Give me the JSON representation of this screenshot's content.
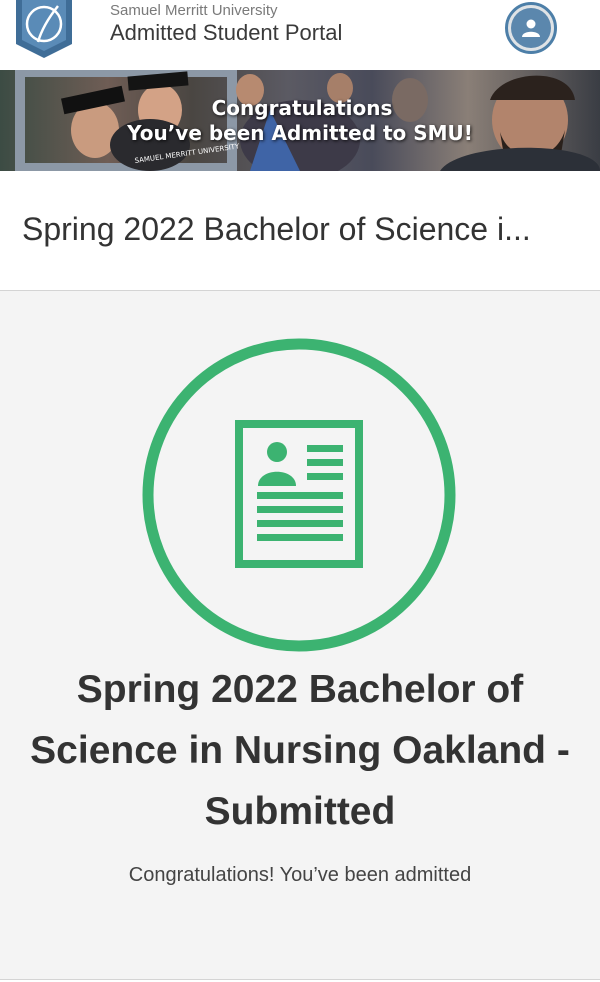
{
  "header": {
    "university": "Samuel Merritt University",
    "portal": "Admitted Student Portal"
  },
  "banner": {
    "line1": "Congratulations",
    "line2": "You’ve been Admitted to SMU!",
    "frame_text": "SAMUEL MERRITT UNIVERSITY"
  },
  "program": {
    "title": "Spring 2022 Bachelor of Science i..."
  },
  "status": {
    "title": "Spring 2022 Bachelor of Science in Nursing Oakland - Submitted",
    "subtitle": "Congratulations! You’ve been admitted"
  },
  "icons": {
    "logo": "university-shield-logo",
    "avatar": "user-icon",
    "document": "application-document-icon"
  },
  "colors": {
    "accent_green": "#3cb371",
    "avatar_blue": "#4d7fa8",
    "logo_blue": "#3f6d97"
  }
}
